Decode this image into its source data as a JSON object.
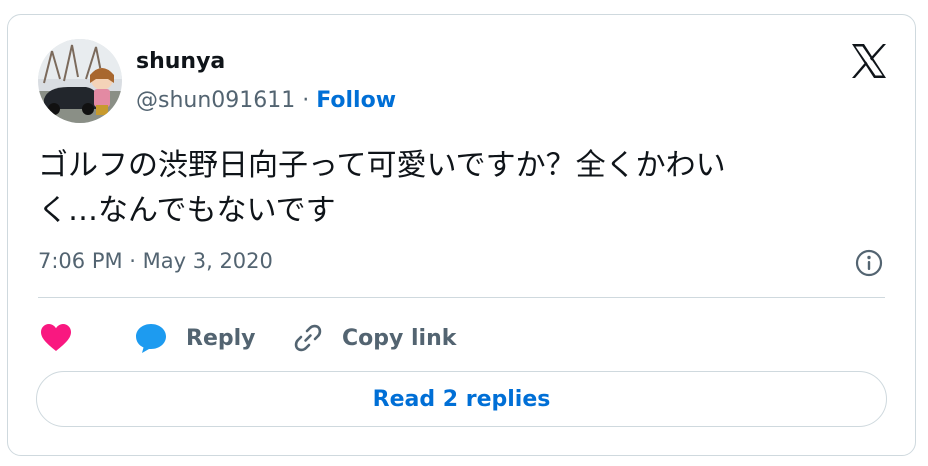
{
  "tweet": {
    "author": {
      "display_name": "shunya",
      "handle": "@shun091611",
      "separator": " · ",
      "follow_label": "Follow",
      "avatar_icon": "avatar-photo"
    },
    "brand_icon": "x-logo-icon",
    "text_line1": "ゴルフの渋野日向子って可愛いですか？全くかわい",
    "text_line2": "く…なんでもないです",
    "timestamp": "7:06 PM · May 3, 2020",
    "info_icon": "info-icon",
    "actions": {
      "like_icon": "heart-icon",
      "reply_icon": "reply-bubble-icon",
      "reply_label": "Reply",
      "copy_icon": "link-icon",
      "copy_label": "Copy link"
    },
    "read_replies_label": "Read 2 replies"
  },
  "colors": {
    "text_primary": "#0f1419",
    "text_secondary": "#536471",
    "link_blue": "#006fd6",
    "like_pink": "#f91880",
    "reply_blue": "#1d9bf0",
    "border": "#cfd9de"
  }
}
